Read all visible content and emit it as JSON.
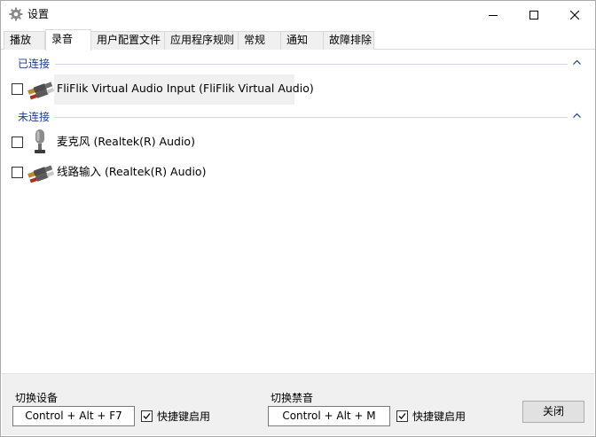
{
  "window": {
    "title": "设置",
    "icon": "gear-icon",
    "controls": [
      "minimize-icon",
      "maximize-icon",
      "close-icon"
    ]
  },
  "tabs": [
    {
      "label": "播放",
      "active": false
    },
    {
      "label": "录音",
      "active": true
    },
    {
      "label": "用户配置文件",
      "active": false
    },
    {
      "label": "应用程序规则",
      "active": false
    },
    {
      "label": "常规",
      "active": false
    },
    {
      "label": "通知",
      "active": false
    },
    {
      "label": "故障排除",
      "active": false
    }
  ],
  "groups": {
    "connected": {
      "title": "已连接",
      "devices": [
        {
          "label": "FliFlik Virtual Audio Input (FliFlik Virtual Audio)",
          "icon": "line-in-cable-icon",
          "checked": false,
          "selected": true
        }
      ]
    },
    "disconnected": {
      "title": "未连接",
      "devices": [
        {
          "label": "麦克风 (Realtek(R) Audio)",
          "icon": "microphone-icon",
          "checked": false,
          "selected": false
        },
        {
          "label": "线路输入 (Realtek(R) Audio)",
          "icon": "line-in-cable-icon",
          "checked": false,
          "selected": false
        }
      ]
    }
  },
  "footer": {
    "switch_device": {
      "label": "切换设备",
      "hotkey": "Control + Alt + F7",
      "enable_label": "快捷键启用",
      "enabled": true
    },
    "switch_mute": {
      "label": "切换禁音",
      "hotkey": "Control + Alt + M",
      "enable_label": "快捷键启用",
      "enabled": true
    },
    "close_label": "关闭"
  }
}
